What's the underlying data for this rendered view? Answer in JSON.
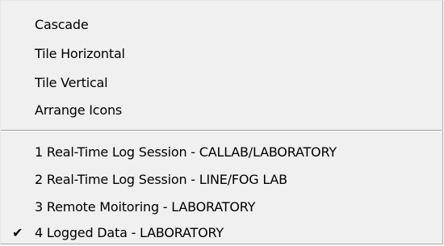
{
  "menu": {
    "window_items": [
      {
        "label": "Cascade"
      },
      {
        "label": "Tile Horizontal"
      },
      {
        "label": "Tile Vertical"
      },
      {
        "label": "Arrange Icons"
      }
    ],
    "session_items": [
      {
        "label": "1 Real-Time Log Session - CALLAB/LABORATORY",
        "checked": false
      },
      {
        "label": "2 Real-Time Log Session - LINE/FOG LAB",
        "checked": false
      },
      {
        "label": "3 Remote Moitoring - LABORATORY",
        "checked": false
      },
      {
        "label": "4 Logged Data - LABORATORY",
        "checked": true
      }
    ],
    "check_glyph": "✔",
    "check_icon": "checkmark-icon"
  }
}
